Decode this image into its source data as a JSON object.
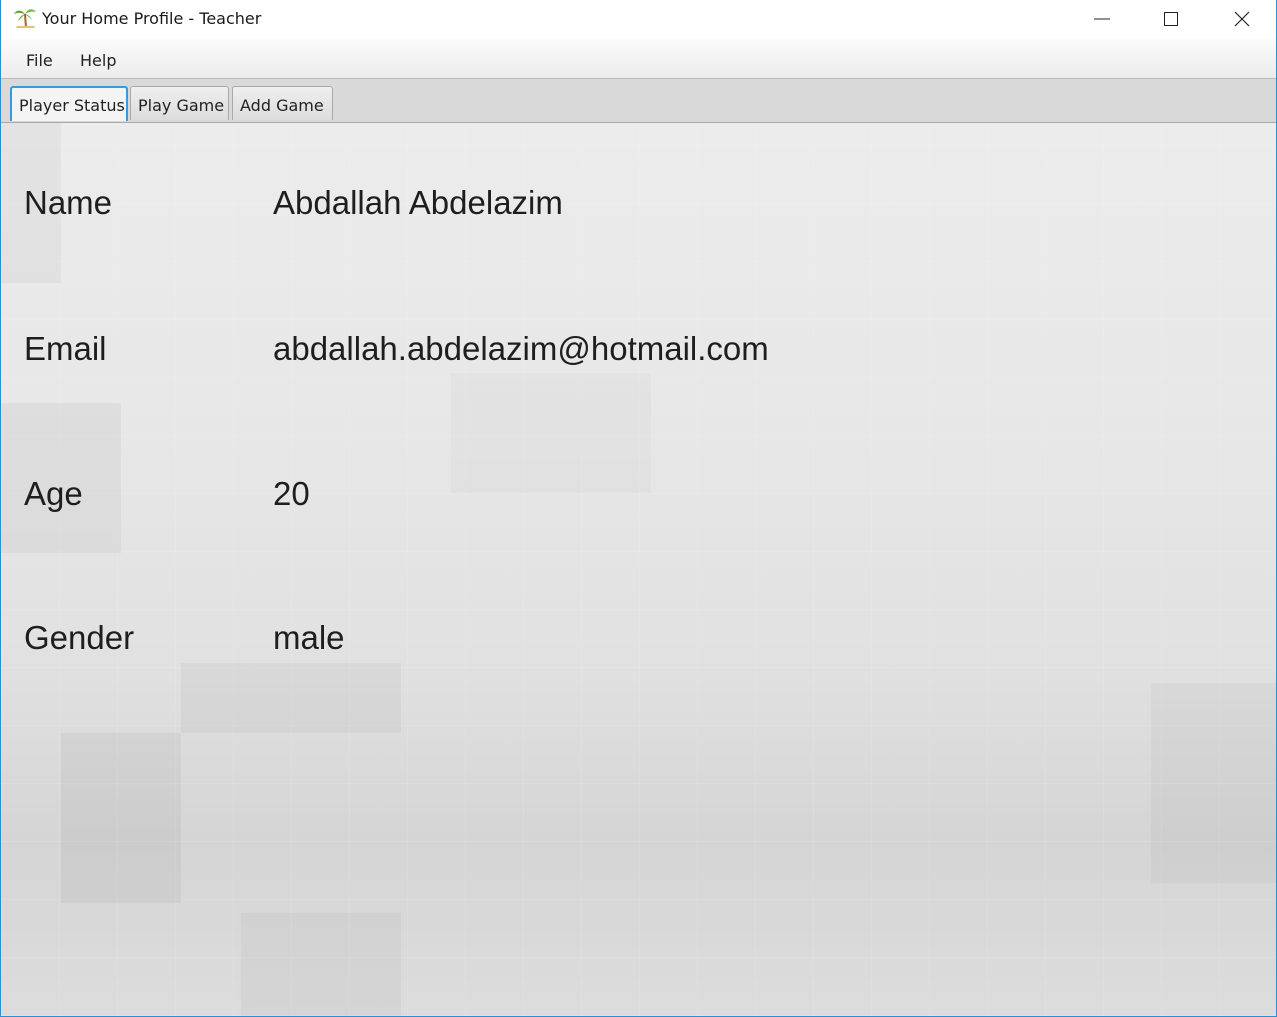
{
  "window": {
    "title": "Your Home Profile - Teacher",
    "icon": "palm-tree-icon",
    "controls": [
      "minimize-icon",
      "maximize-icon",
      "close-icon"
    ]
  },
  "menu": {
    "items": [
      {
        "label": "File"
      },
      {
        "label": "Help"
      }
    ]
  },
  "tabs": [
    {
      "label": "Player Status",
      "active": true
    },
    {
      "label": "Play Game",
      "active": false
    },
    {
      "label": "Add Game",
      "active": false
    }
  ],
  "profile": {
    "fields": [
      {
        "label": "Name",
        "value": "Abdallah Abdelazim"
      },
      {
        "label": "Email",
        "value": "abdallah.abdelazim@hotmail.com"
      },
      {
        "label": "Age",
        "value": "20"
      },
      {
        "label": "Gender",
        "value": "male"
      }
    ]
  },
  "colors": {
    "window_border": "#2b8fd6",
    "active_tab_border": "#3a9ad9",
    "text": "#1e1e1e"
  }
}
